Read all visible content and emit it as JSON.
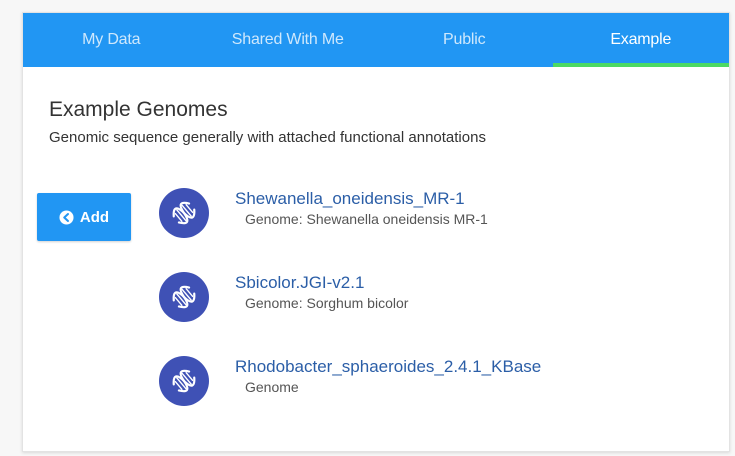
{
  "tabs": [
    {
      "label": "My Data",
      "active": false
    },
    {
      "label": "Shared With Me",
      "active": false
    },
    {
      "label": "Public",
      "active": false
    },
    {
      "label": "Example",
      "active": true
    }
  ],
  "section": {
    "title": "Example Genomes",
    "description": "Genomic sequence generally with attached functional annotations"
  },
  "add_button": {
    "label": "Add",
    "icon": "chevron-circle-left-icon"
  },
  "genomes": [
    {
      "name": "Shewanella_oneidensis_MR-1",
      "subtitle": "Genome: Shewanella oneidensis MR-1",
      "icon": "dna-icon"
    },
    {
      "name": "Sbicolor.JGI-v2.1",
      "subtitle": "Genome: Sorghum bicolor",
      "icon": "dna-icon"
    },
    {
      "name": "Rhodobacter_sphaeroides_2.4.1_KBase",
      "subtitle": "Genome",
      "icon": "dna-icon"
    }
  ],
  "colors": {
    "tab_bar": "#2196f3",
    "active_indicator": "#4cd964",
    "icon_circle": "#3f51b5",
    "link": "#2b5ea7",
    "add_button": "#2196f3"
  }
}
